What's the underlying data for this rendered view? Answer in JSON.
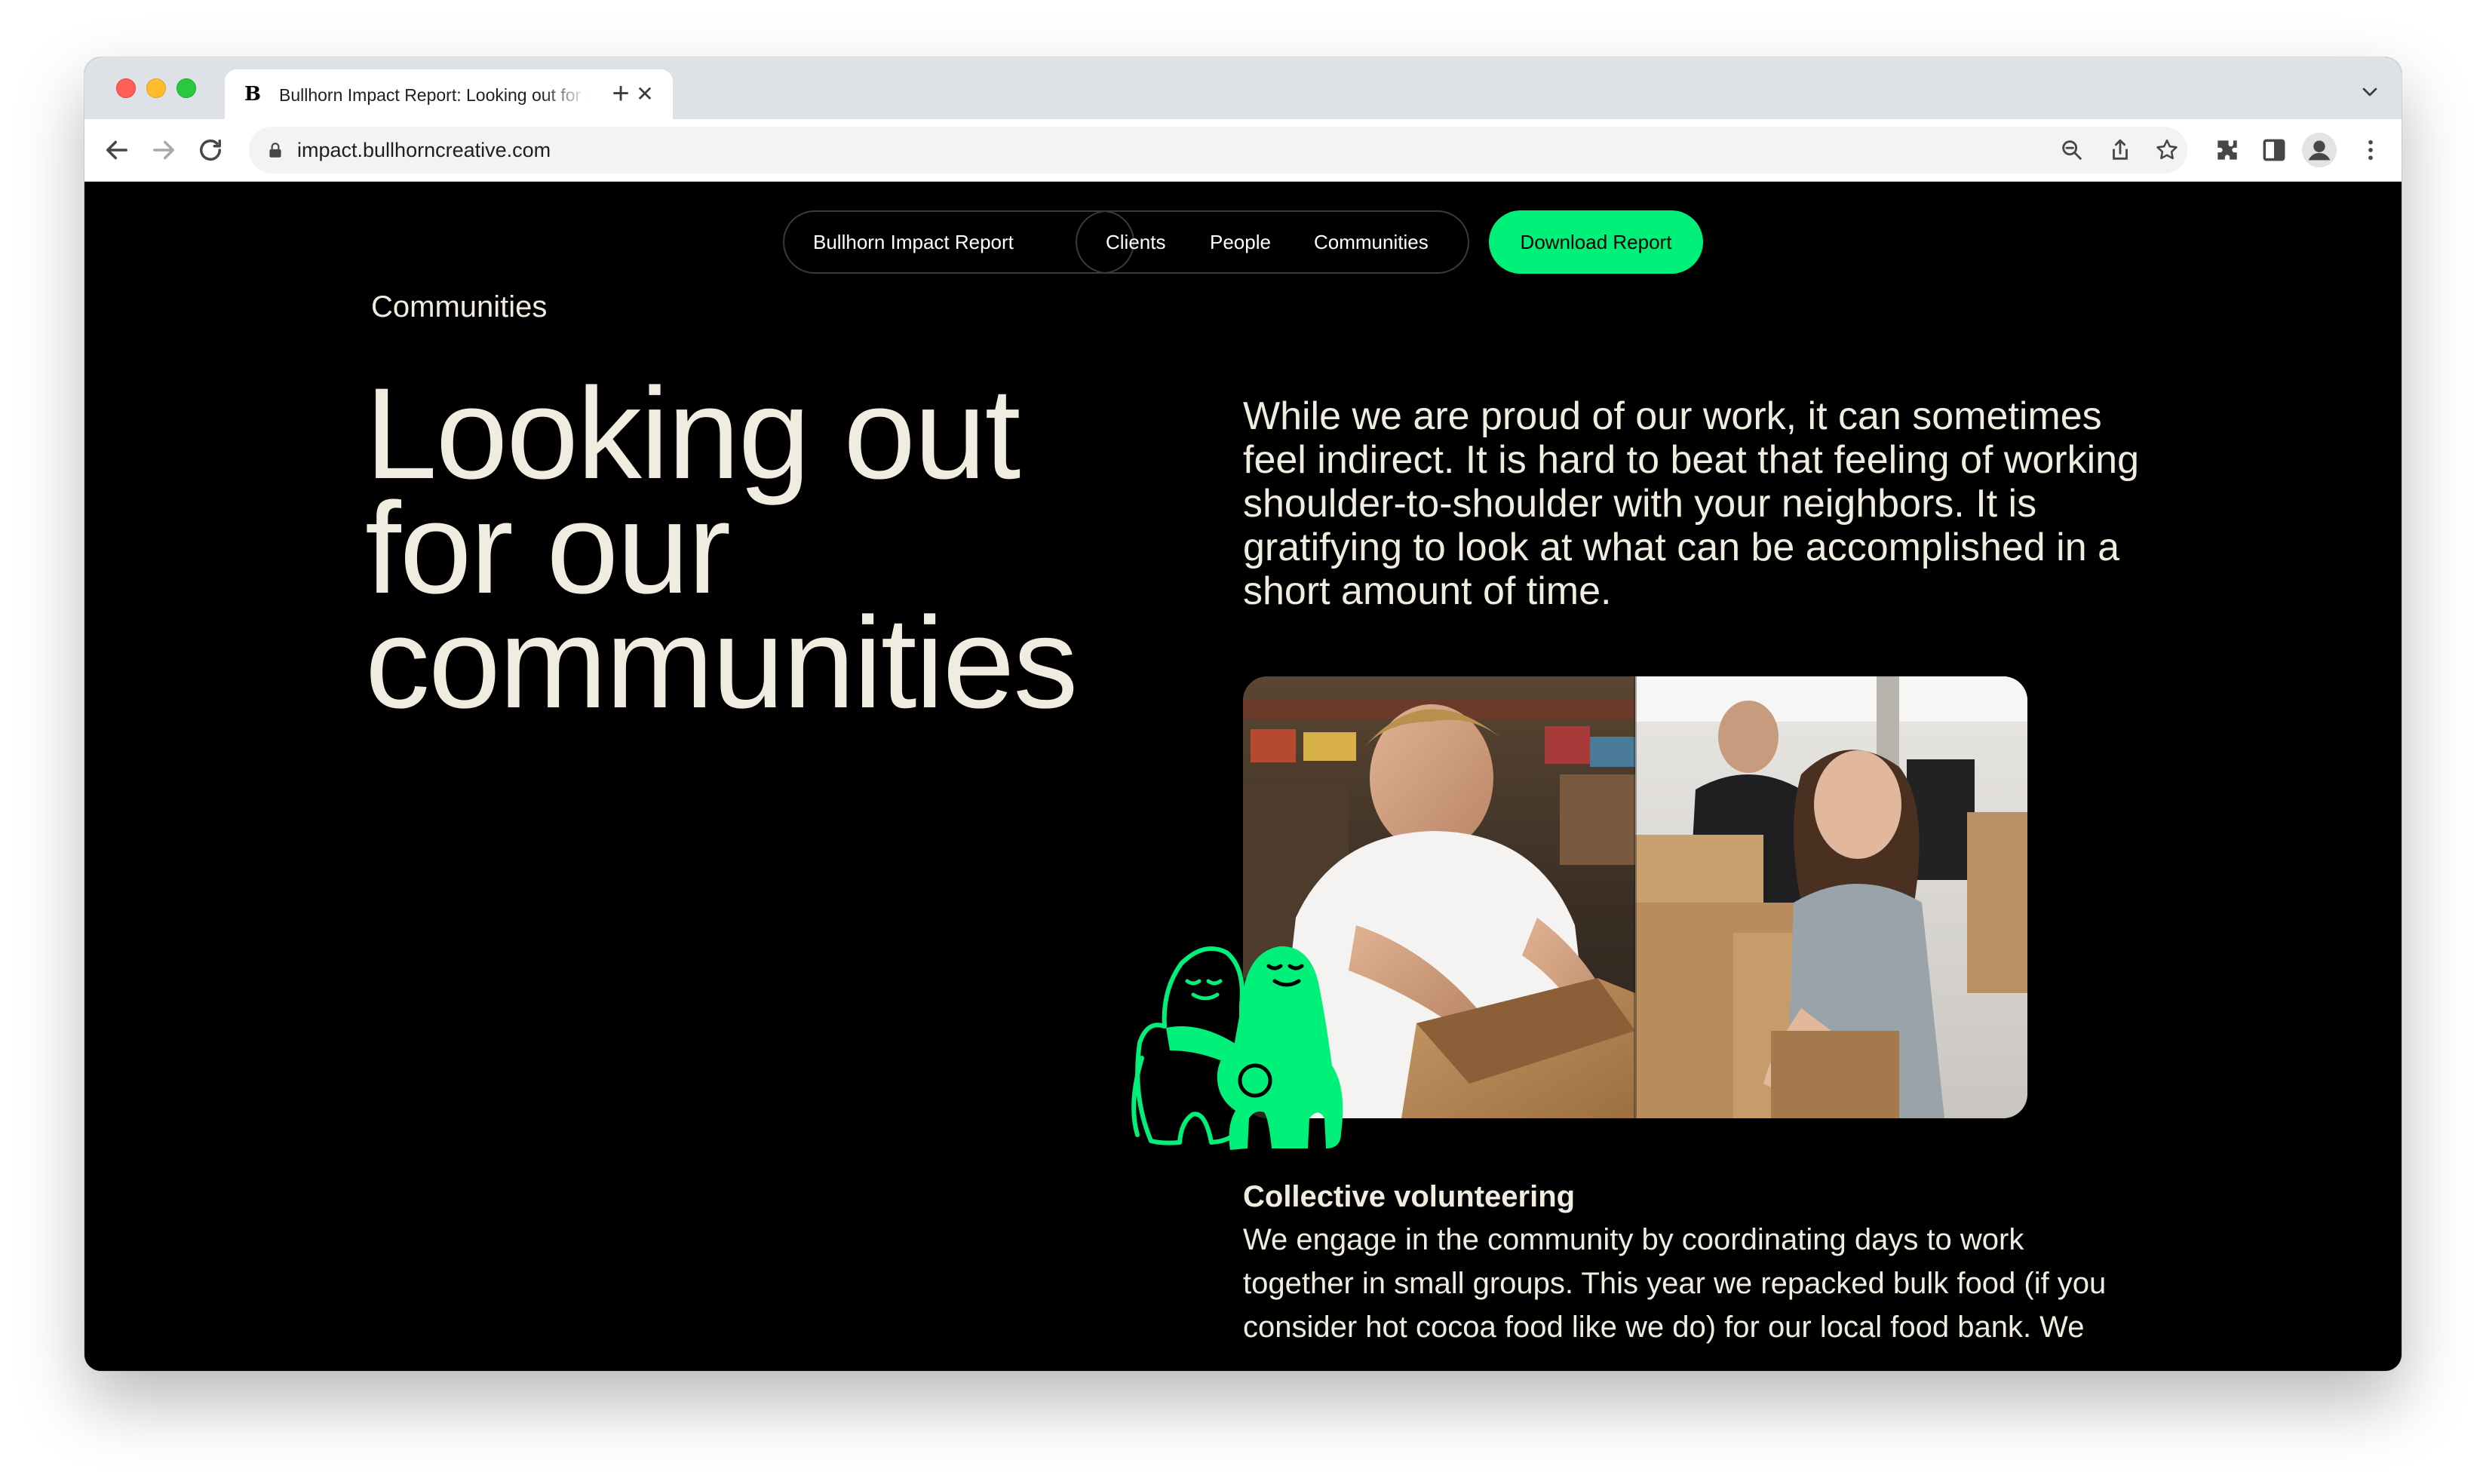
{
  "browser": {
    "tab_favicon": "B",
    "tab_title": "Bullhorn Impact Report: Looking out for our communities",
    "url": "impact.bullhorncreative.com",
    "icons": [
      "back-icon",
      "forward-icon",
      "reload-icon",
      "lock-icon",
      "zoom-icon",
      "share-icon",
      "bookmark-star-icon",
      "extensions-icon",
      "side-panel-icon",
      "profile-icon",
      "menu-icon"
    ]
  },
  "nav": {
    "home_label": "Bullhorn Impact Report",
    "items": [
      {
        "label": "Clients"
      },
      {
        "label": "People"
      },
      {
        "label": "Communities"
      }
    ],
    "cta_label": "Download Report",
    "accent_color": "#00f07a"
  },
  "hero": {
    "section_label": "Communities",
    "title_lines": [
      "Looking out",
      "for our",
      "communities"
    ],
    "intro": "While we are proud of our work, it can sometimes feel indirect. It is hard to beat that feeling of working shoulder-to-shoulder with your neighbors. It is gratifying to look at what can be accomplished in a short amount of time."
  },
  "volunteering": {
    "title": "Collective volunteering",
    "body": "We engage in the community by coordinating days to work together in small groups. This year we repacked bulk food (if you consider hot cocoa food like we do) for our local food bank. We"
  },
  "colors": {
    "page_bg": "#000000",
    "text": "#f1ece0",
    "mascot": "#00f07a"
  }
}
